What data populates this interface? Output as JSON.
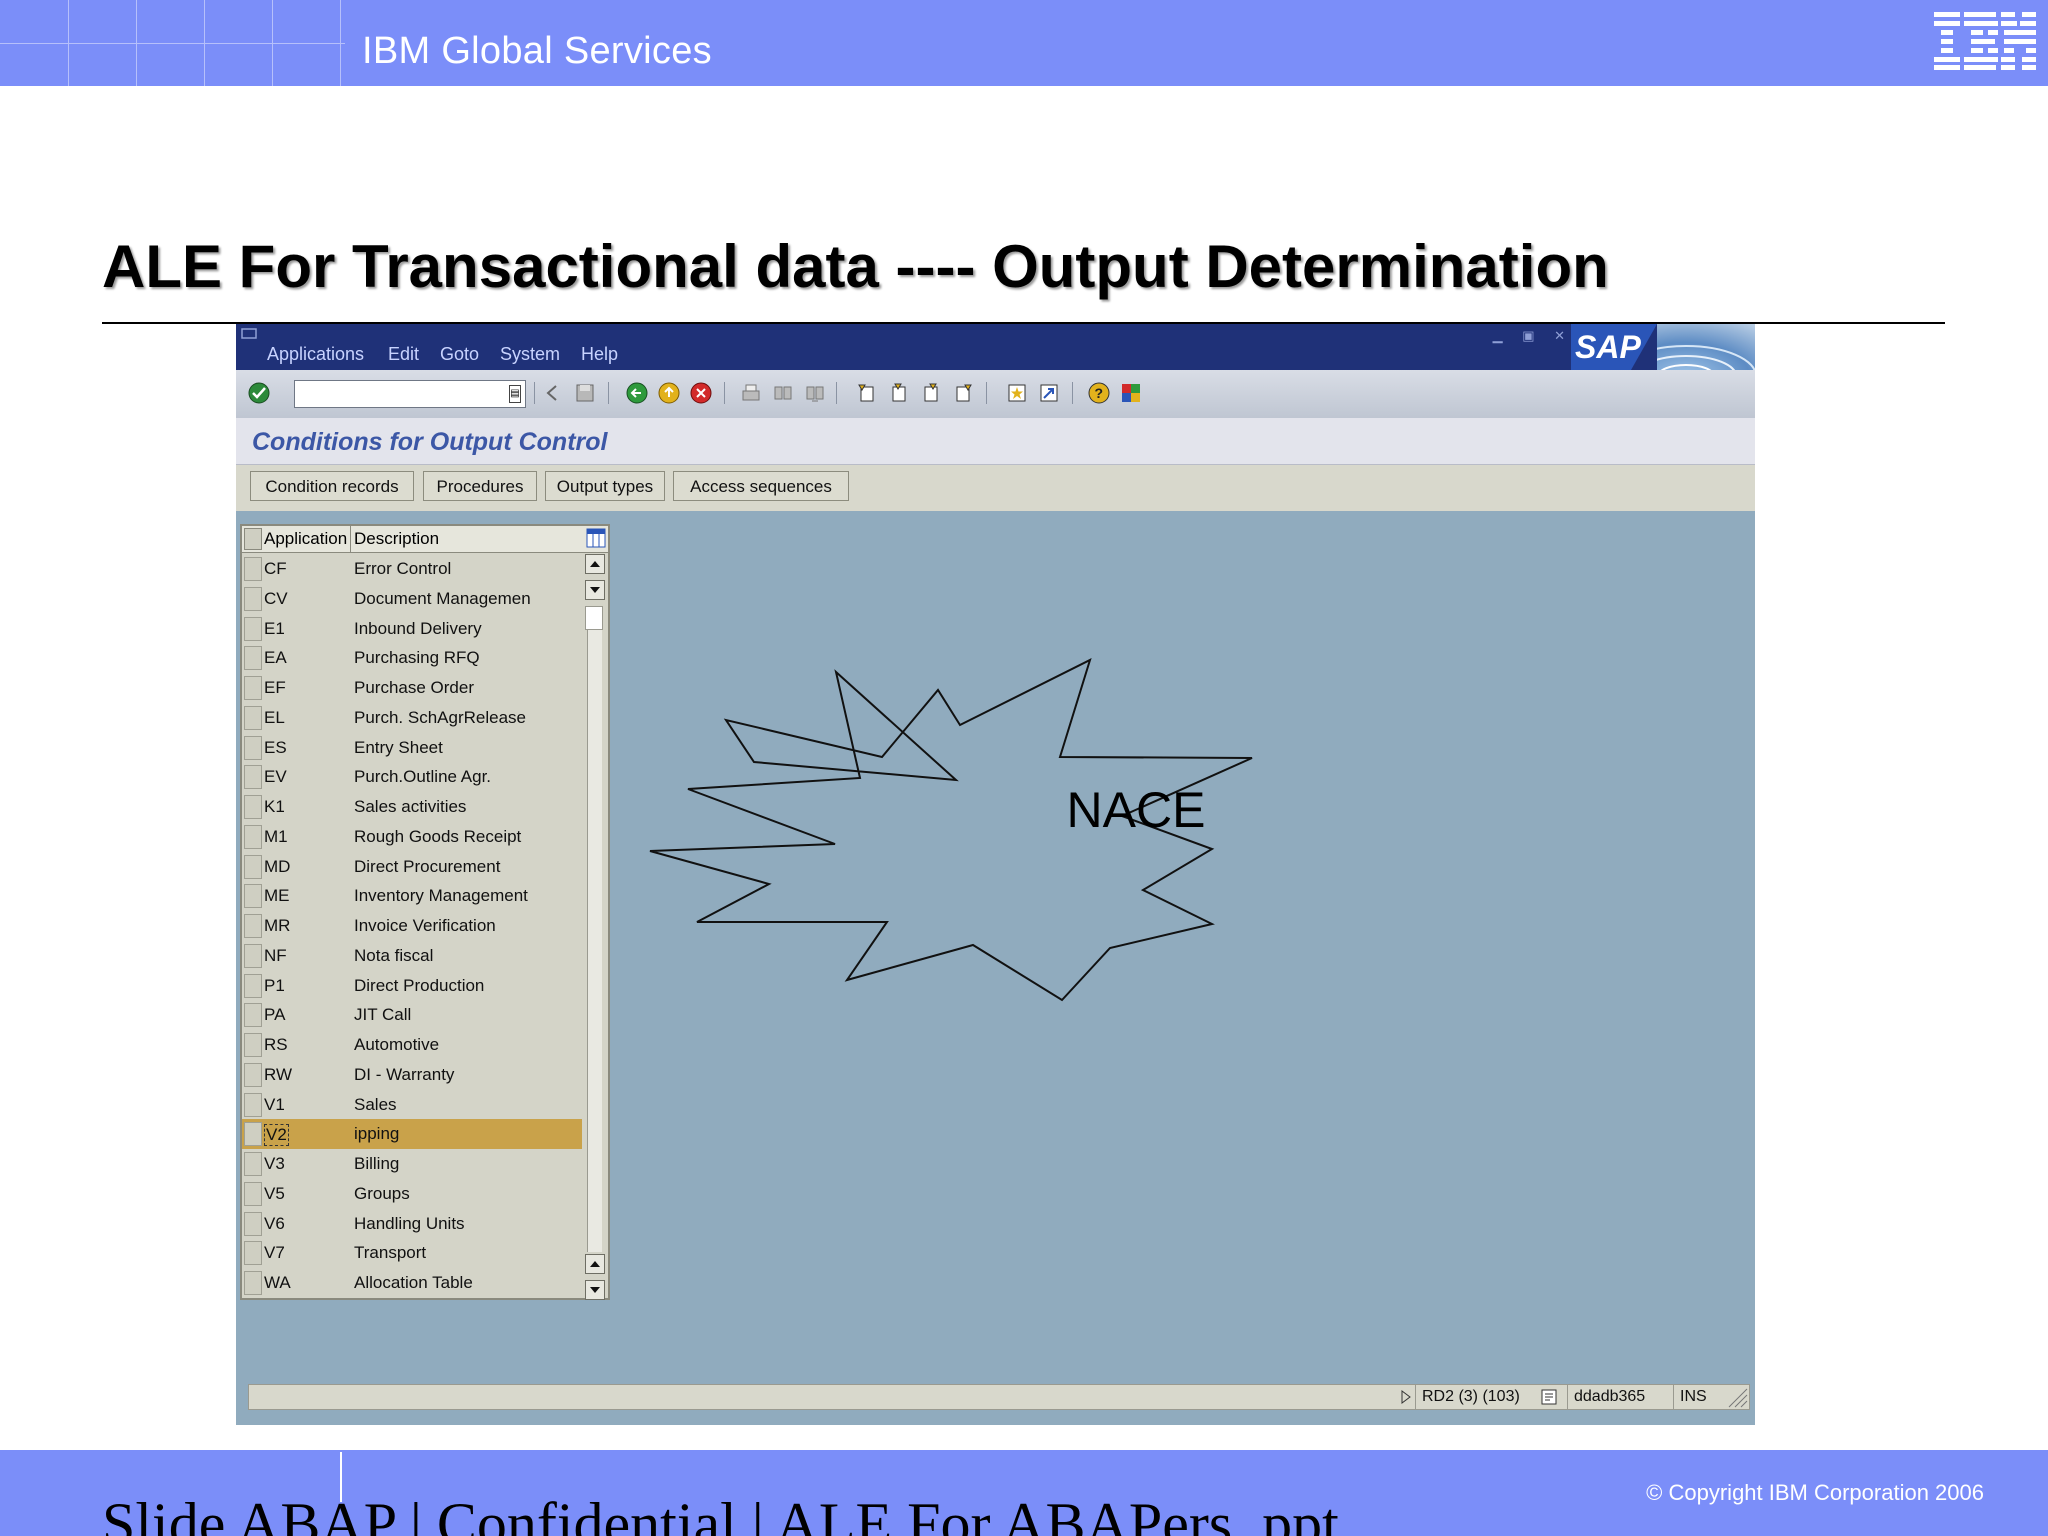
{
  "header": {
    "title": "IBM Global Services",
    "logo": "IBM"
  },
  "slide": {
    "title": "ALE For Transactional data ---- Output Determination"
  },
  "sap": {
    "menu": [
      "Applications",
      "Edit",
      "Goto",
      "System",
      "Help"
    ],
    "logo": "SAP",
    "command_field": {
      "value": ""
    },
    "screen_title": "Conditions for Output Control",
    "app_buttons": [
      "Condition records",
      "Procedures",
      "Output types",
      "Access sequences"
    ],
    "table": {
      "headers": [
        "Application",
        "Description"
      ],
      "rows": [
        {
          "app": "CF",
          "desc": "Error Control"
        },
        {
          "app": "CV",
          "desc": "Document Managemen"
        },
        {
          "app": "E1",
          "desc": "Inbound Delivery"
        },
        {
          "app": "EA",
          "desc": "Purchasing RFQ"
        },
        {
          "app": "EF",
          "desc": "Purchase Order"
        },
        {
          "app": "EL",
          "desc": "Purch. SchAgrRelease"
        },
        {
          "app": "ES",
          "desc": "Entry Sheet"
        },
        {
          "app": "EV",
          "desc": "Purch.Outline Agr."
        },
        {
          "app": "K1",
          "desc": "Sales activities"
        },
        {
          "app": "M1",
          "desc": "Rough Goods Receipt"
        },
        {
          "app": "MD",
          "desc": "Direct Procurement"
        },
        {
          "app": "ME",
          "desc": "Inventory Management"
        },
        {
          "app": "MR",
          "desc": "Invoice Verification"
        },
        {
          "app": "NF",
          "desc": "Nota fiscal"
        },
        {
          "app": "P1",
          "desc": "Direct Production"
        },
        {
          "app": "PA",
          "desc": "JIT Call"
        },
        {
          "app": "RS",
          "desc": "Automotive"
        },
        {
          "app": "RW",
          "desc": "DI - Warranty"
        },
        {
          "app": "V1",
          "desc": "Sales"
        },
        {
          "app": "V2",
          "desc": "ipping"
        },
        {
          "app": "V3",
          "desc": "Billing"
        },
        {
          "app": "V5",
          "desc": "Groups"
        },
        {
          "app": "V6",
          "desc": "Handling Units"
        },
        {
          "app": "V7",
          "desc": "Transport"
        },
        {
          "app": "WA",
          "desc": "Allocation Table"
        }
      ],
      "selected_index": 19
    },
    "status": {
      "system": "RD2 (3) (103)",
      "server": "ddadb365",
      "mode": "INS"
    },
    "callout": "NACE",
    "colors": {
      "menubar": "#1f3178",
      "background": "#90abbe",
      "highlight": "#c9a24a"
    }
  },
  "footer": {
    "copyright": "© Copyright IBM Corporation 2006",
    "text": "Slide        ABAP | Confidential |   ALE For ABAPers .ppt"
  }
}
